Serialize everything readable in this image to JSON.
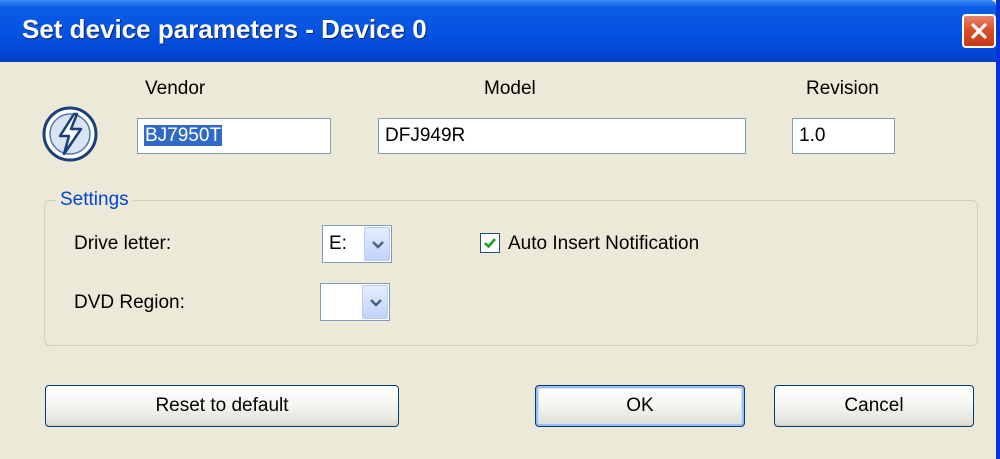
{
  "window": {
    "title": "Set device parameters - Device 0",
    "close_icon": "close-icon"
  },
  "device": {
    "vendor_label": "Vendor",
    "vendor_value": "BJ7950T",
    "model_label": "Model",
    "model_value": "DFJ949R",
    "revision_label": "Revision",
    "revision_value": "1.0",
    "icon": "lightning-disc-icon"
  },
  "settings": {
    "group_label": "Settings",
    "drive_letter_label": "Drive letter:",
    "drive_letter_value": "E:",
    "dvd_region_label": "DVD Region:",
    "dvd_region_value": "",
    "auto_insert_label": "Auto Insert Notification",
    "auto_insert_checked": true
  },
  "buttons": {
    "reset_label": "Reset to default",
    "ok_label": "OK",
    "cancel_label": "Cancel"
  },
  "colors": {
    "titlebar": "#0553e2",
    "dialog_bg": "#ece9d8",
    "group_label": "#0046d5",
    "close_button": "#d9502c"
  }
}
